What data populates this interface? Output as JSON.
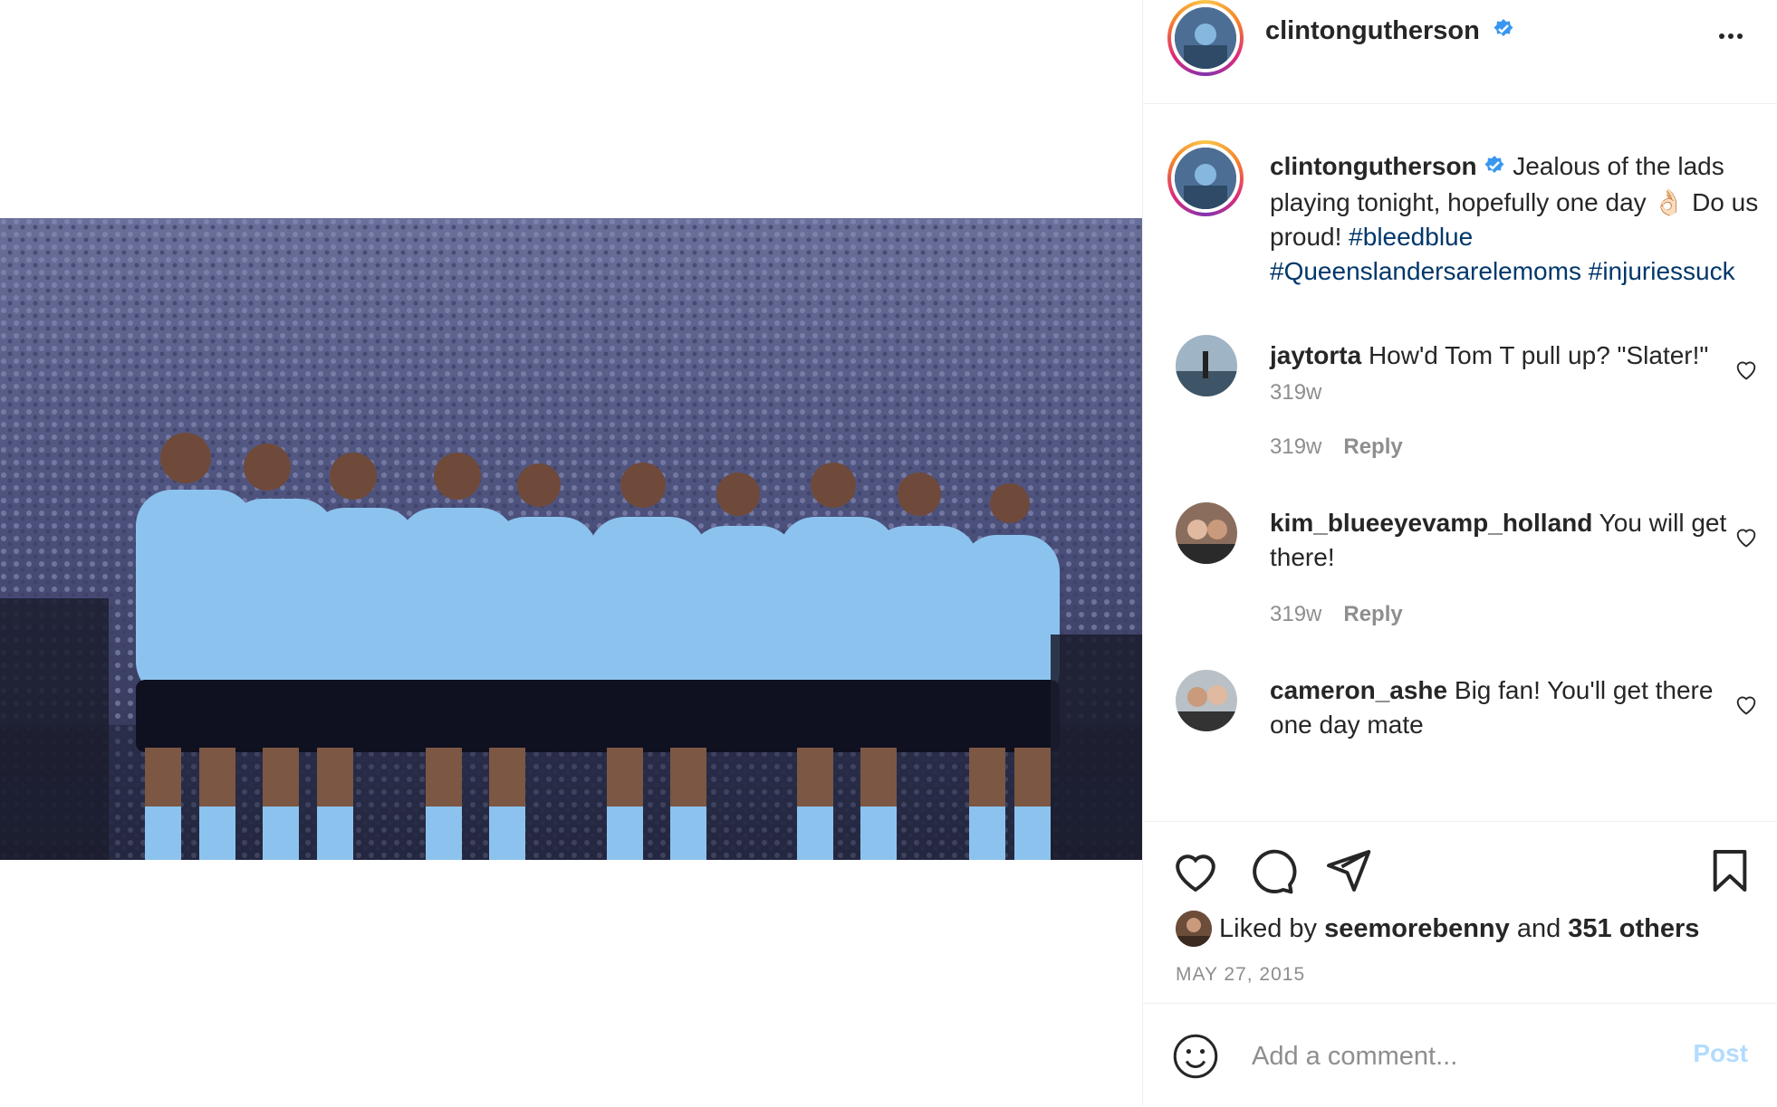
{
  "post": {
    "username": "clintongutherson",
    "caption_text": "Jealous of the lads playing tonight, hopefully one day ",
    "caption_emoji": "👌🏻",
    "caption_text2": " Do us proud! ",
    "hashtags": [
      "#bleedblue",
      "#Queenslandersarelemoms",
      "#injuriessuck"
    ],
    "caption_time": "319w",
    "likes_prefix": "Liked by",
    "liked_by_user": "seemorebenny",
    "likes_and": "and",
    "likes_others": "351 others",
    "date": "MAY 27, 2015"
  },
  "comments": [
    {
      "username": "jaytorta",
      "text": "How'd Tom T pull up? \"Slater!\"",
      "time": "319w",
      "reply": "Reply"
    },
    {
      "username": "kim_blueeyevamp_holland",
      "text": "You will get there!",
      "time": "319w",
      "reply": "Reply"
    },
    {
      "username": "cameron_ashe",
      "text": "Big fan! You'll get there one day mate"
    }
  ],
  "add_comment": {
    "placeholder": "Add a comment...",
    "post_label": "Post"
  },
  "colors": {
    "accent_blue": "#0095f6",
    "hashtag": "#00376b",
    "post_disabled": "#b3dbff",
    "verified": "#3897f0"
  },
  "icons": [
    "more-options-icon",
    "verified-badge-icon",
    "heart-icon",
    "comment-icon",
    "share-icon",
    "bookmark-icon",
    "emoji-icon"
  ]
}
